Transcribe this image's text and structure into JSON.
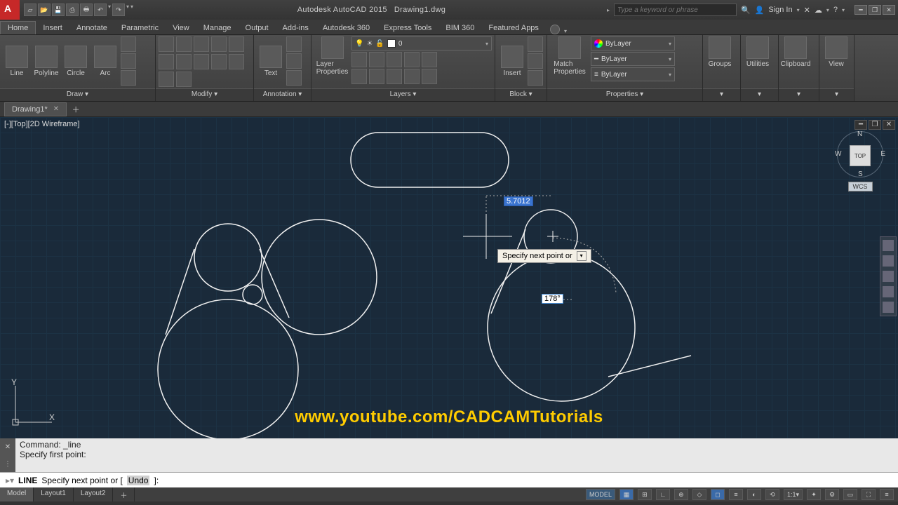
{
  "title": {
    "app": "Autodesk AutoCAD 2015",
    "doc": "Drawing1.dwg"
  },
  "search_placeholder": "Type a keyword or phrase",
  "signin": "Sign In",
  "ribbon_tabs": [
    "Home",
    "Insert",
    "Annotate",
    "Parametric",
    "View",
    "Manage",
    "Output",
    "Add-ins",
    "Autodesk 360",
    "Express Tools",
    "BIM 360",
    "Featured Apps"
  ],
  "active_tab": "Home",
  "panels": {
    "draw": {
      "title": "Draw ▾",
      "tools": [
        "Line",
        "Polyline",
        "Circle",
        "Arc"
      ]
    },
    "modify": {
      "title": "Modify ▾"
    },
    "annotation": {
      "title": "Annotation ▾",
      "text_label": "Text"
    },
    "layers": {
      "title": "Layers ▾",
      "layer_props": "Layer\nProperties",
      "current": "0"
    },
    "block": {
      "title": "Block ▾",
      "insert": "Insert"
    },
    "properties": {
      "title": "Properties ▾",
      "match": "Match\nProperties",
      "color": "ByLayer",
      "ltype": "ByLayer",
      "lweight": "ByLayer"
    },
    "groups": {
      "title": "Groups"
    },
    "utilities": {
      "title": "Utilities"
    },
    "clipboard": {
      "title": "Clipboard"
    },
    "view": {
      "title": "View"
    }
  },
  "doctab": {
    "name": "Drawing1*"
  },
  "viewport_label": "[-][Top][2D Wireframe]",
  "dyn": {
    "dist": "5.7012",
    "angle": "178°",
    "prompt": "Specify next point or"
  },
  "viewcube": {
    "n": "N",
    "s": "S",
    "e": "E",
    "w": "W",
    "face": "TOP",
    "wcs": "WCS"
  },
  "ucs": {
    "x": "X",
    "y": "Y"
  },
  "watermark": "www.youtube.com/CADCAMTutorials",
  "cmd": {
    "line1": "Command: _line",
    "line2": "Specify first point:",
    "prompt_cmd": "LINE",
    "prompt_rest": "Specify next point or [",
    "prompt_kw": "Undo",
    "prompt_end": "]:"
  },
  "model_tabs": [
    "Model",
    "Layout1",
    "Layout2"
  ],
  "status": {
    "model": "MODEL",
    "scale": "1:1"
  }
}
